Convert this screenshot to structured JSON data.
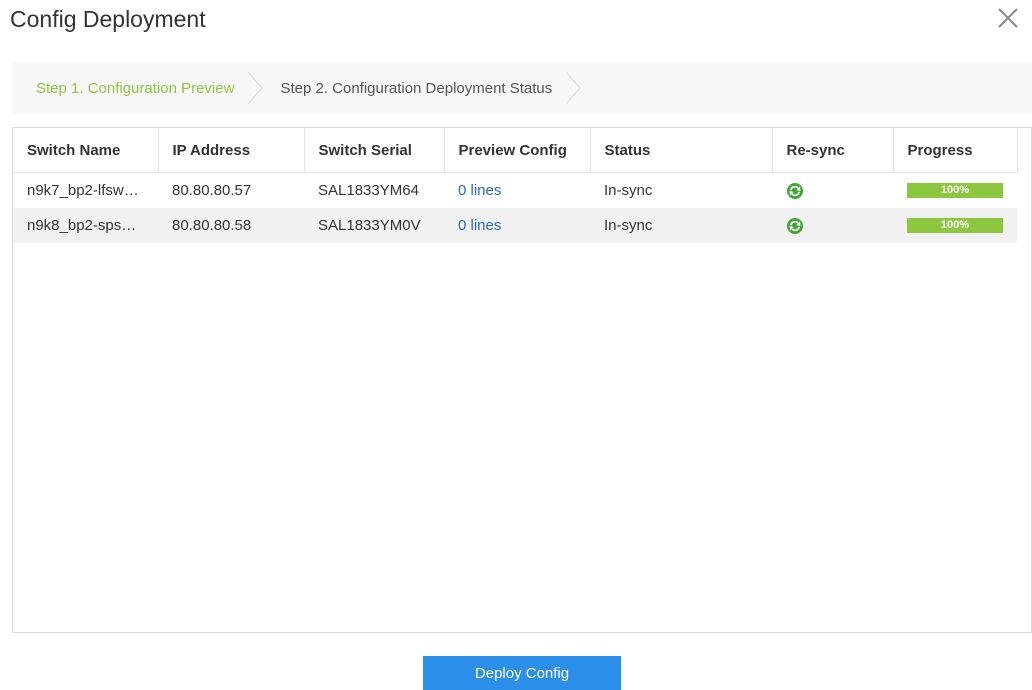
{
  "dialog": {
    "title": "Config Deployment"
  },
  "steps": [
    {
      "label": "Step 1. Configuration Preview",
      "active": true
    },
    {
      "label": "Step 2. Configuration Deployment Status",
      "active": false
    }
  ],
  "table": {
    "columns": [
      "Switch Name",
      "IP Address",
      "Switch Serial",
      "Preview Config",
      "Status",
      "Re-sync",
      "Progress"
    ],
    "rows": [
      {
        "switch_name": "n9k7_bp2-lfsw…",
        "ip": "80.80.80.57",
        "serial": "SAL1833YM64",
        "preview": "0 lines",
        "status": "In-sync",
        "resync_icon": "resync-icon",
        "progress_label": "100%",
        "progress": 1.0
      },
      {
        "switch_name": "n9k8_bp2-sps…",
        "ip": "80.80.80.58",
        "serial": "SAL1833YM0V",
        "preview": "0 lines",
        "status": "In-sync",
        "resync_icon": "resync-icon",
        "progress_label": "100%",
        "progress": 1.0
      }
    ]
  },
  "footer": {
    "deploy_label": "Deploy Config"
  },
  "colors": {
    "accent": "#8dc63f",
    "link": "#2a6ebb",
    "button": "#2b8ee8"
  }
}
